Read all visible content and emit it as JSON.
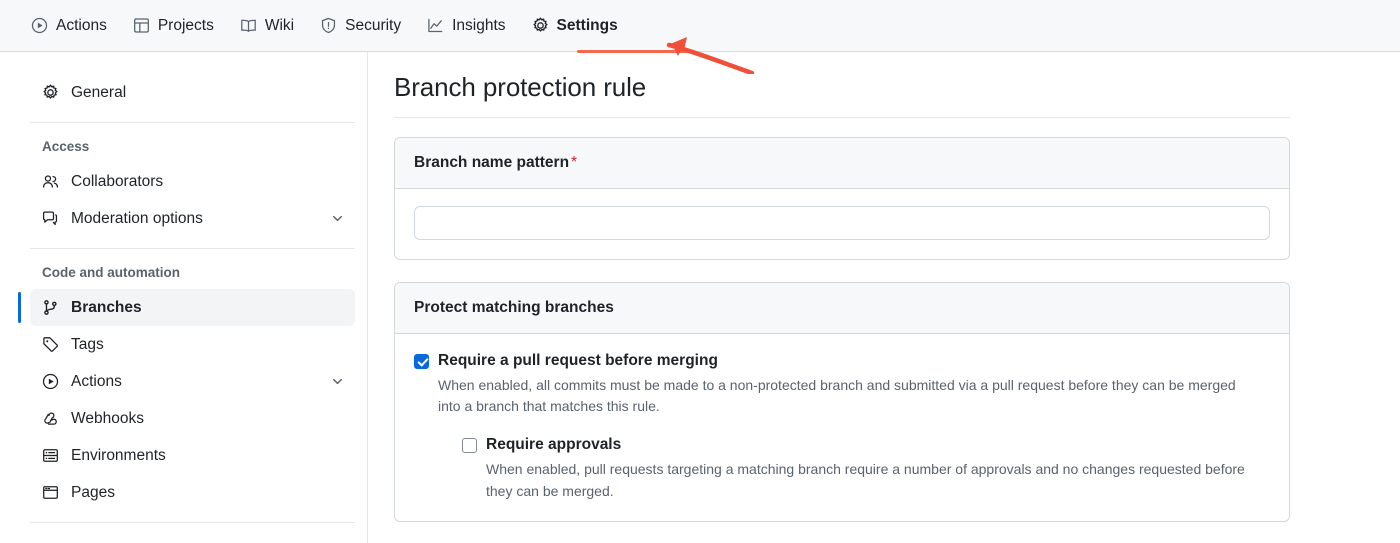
{
  "topnav": {
    "tabs": [
      {
        "label": "Actions",
        "icon": "play-circle-icon",
        "active": false
      },
      {
        "label": "Projects",
        "icon": "table-icon",
        "active": false
      },
      {
        "label": "Wiki",
        "icon": "book-icon",
        "active": false
      },
      {
        "label": "Security",
        "icon": "shield-icon",
        "active": false
      },
      {
        "label": "Insights",
        "icon": "graph-icon",
        "active": false
      },
      {
        "label": "Settings",
        "icon": "gear-icon",
        "active": true
      }
    ],
    "active_tab": "Settings",
    "underline_color": "#f26a4b"
  },
  "annotation": {
    "type": "arrow",
    "color": "#f0503a",
    "points_to": "settings-tab-underline"
  },
  "sidebar": {
    "top_items": [
      {
        "label": "General",
        "icon": "gear-icon",
        "chevron": false,
        "selected": false
      }
    ],
    "groups": [
      {
        "title": "Access",
        "items": [
          {
            "label": "Collaborators",
            "icon": "people-icon",
            "chevron": false,
            "selected": false
          },
          {
            "label": "Moderation options",
            "icon": "comment-icon",
            "chevron": true,
            "selected": false
          }
        ]
      },
      {
        "title": "Code and automation",
        "items": [
          {
            "label": "Branches",
            "icon": "git-branch-icon",
            "chevron": false,
            "selected": true
          },
          {
            "label": "Tags",
            "icon": "tag-icon",
            "chevron": false,
            "selected": false
          },
          {
            "label": "Actions",
            "icon": "play-circle-icon",
            "chevron": true,
            "selected": false
          },
          {
            "label": "Webhooks",
            "icon": "webhook-icon",
            "chevron": false,
            "selected": false
          },
          {
            "label": "Environments",
            "icon": "server-icon",
            "chevron": false,
            "selected": false
          },
          {
            "label": "Pages",
            "icon": "browser-icon",
            "chevron": false,
            "selected": false
          }
        ]
      }
    ],
    "accent_color": "#0969da"
  },
  "main": {
    "page_title": "Branch protection rule",
    "pattern_card": {
      "header_label": "Branch name pattern",
      "required_marker": "*",
      "input_value": "",
      "input_placeholder": ""
    },
    "protect_card": {
      "header_label": "Protect matching branches",
      "options": [
        {
          "label": "Require a pull request before merging",
          "checked": true,
          "description": "When enabled, all commits must be made to a non-protected branch and submitted via a pull request before they can be merged into a branch that matches this rule."
        },
        {
          "label": "Require approvals",
          "checked": false,
          "description": "When enabled, pull requests targeting a matching branch require a number of approvals and no changes requested before they can be merged."
        }
      ]
    }
  }
}
